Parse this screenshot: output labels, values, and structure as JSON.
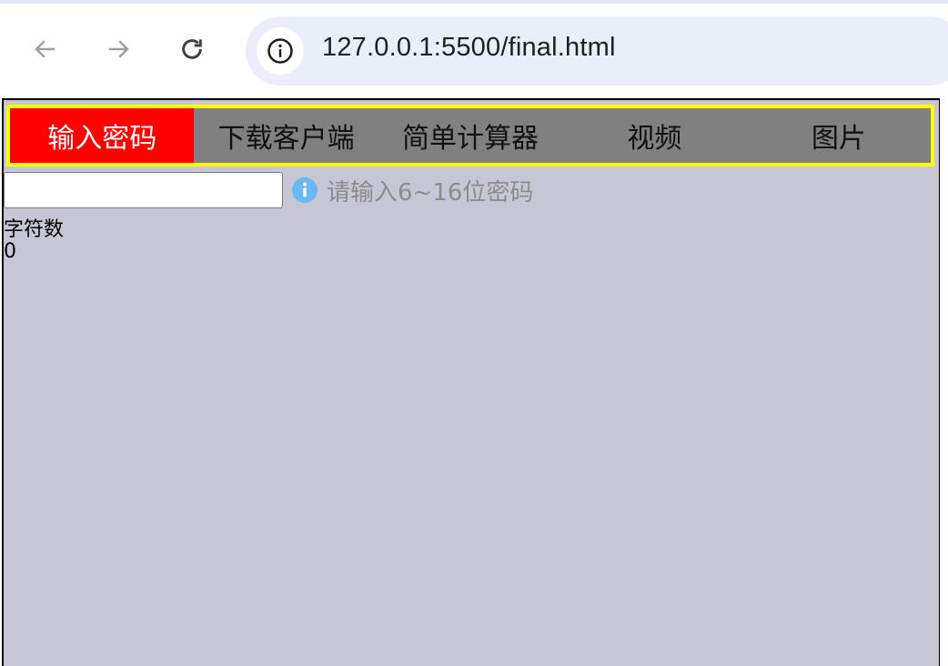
{
  "browser": {
    "url": "127.0.0.1:5500/final.html"
  },
  "navbar": {
    "items": [
      {
        "label": "输入密码",
        "active": true
      },
      {
        "label": "下载客户端",
        "active": false
      },
      {
        "label": "简单计算器",
        "active": false
      },
      {
        "label": "视频",
        "active": false
      },
      {
        "label": "图片",
        "active": false
      }
    ]
  },
  "password": {
    "value": "",
    "hint": "请输入6~16位密码"
  },
  "counter": {
    "label": "字符数",
    "value": "0"
  },
  "colors": {
    "page_bg": "#c7c6d4",
    "nav_bg": "#808080",
    "nav_border": "#ffff00",
    "nav_active": "#ff0000",
    "hint": "#8c8c8c",
    "info_icon": "#6ab8f0"
  },
  "icons": {
    "back": "arrow-left-icon",
    "forward": "arrow-right-icon",
    "reload": "reload-icon",
    "site_info": "info-icon",
    "hint": "info-circle-icon"
  }
}
